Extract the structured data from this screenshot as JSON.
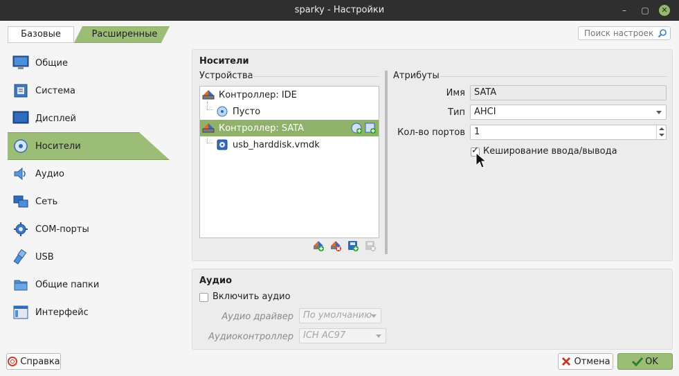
{
  "window": {
    "title": "sparky - Настройки"
  },
  "mode_tabs": {
    "basic": "Базовые",
    "advanced": "Расширенные"
  },
  "search": {
    "placeholder": "Поиск настроек"
  },
  "sidebar": {
    "items": [
      {
        "label": "Общие",
        "icon": "general-monitor-icon"
      },
      {
        "label": "Система",
        "icon": "system-chip-icon"
      },
      {
        "label": "Дисплей",
        "icon": "display-monitor-icon"
      },
      {
        "label": "Носители",
        "icon": "storage-disk-icon",
        "selected": true
      },
      {
        "label": "Аудио",
        "icon": "audio-speaker-icon"
      },
      {
        "label": "Сеть",
        "icon": "network-icon"
      },
      {
        "label": "COM-порты",
        "icon": "serial-port-icon"
      },
      {
        "label": "USB",
        "icon": "usb-icon"
      },
      {
        "label": "Общие папки",
        "icon": "shared-folder-icon"
      },
      {
        "label": "Интерфейс",
        "icon": "interface-window-icon"
      }
    ]
  },
  "storage": {
    "title": "Носители",
    "devices_label": "Устройства",
    "attributes_label": "Атрибуты",
    "tree": [
      {
        "label": "Контроллер: IDE",
        "icon": "ide-controller-icon"
      },
      {
        "label": "Пусто",
        "icon": "optical-disc-icon"
      },
      {
        "label": "Контроллер: SATA",
        "icon": "sata-controller-icon",
        "selected": true
      },
      {
        "label": "usb_harddisk.vmdk",
        "icon": "hard-disk-icon"
      }
    ],
    "form": {
      "name_label": "Имя",
      "name_value": "SATA",
      "type_label": "Тип",
      "type_value": "AHCI",
      "ports_label": "Кол-во портов",
      "ports_value": "1",
      "cache_label": "Кеширование ввода/вывода",
      "cache_checked": true
    }
  },
  "audio": {
    "title": "Аудио",
    "enable_label": "Включить аудио",
    "enable_checked": false,
    "driver_label": "Аудио драйвер",
    "driver_value": "По умолчанию",
    "controller_label": "Аудиоконтроллер",
    "controller_value": "ICH AC97"
  },
  "buttons": {
    "help": "Справка",
    "cancel": "Отмена",
    "ok": "OK"
  },
  "colors": {
    "accent": "#9bbd75",
    "selection": "#8fb16a",
    "titlebar": "#2f2f2f"
  }
}
